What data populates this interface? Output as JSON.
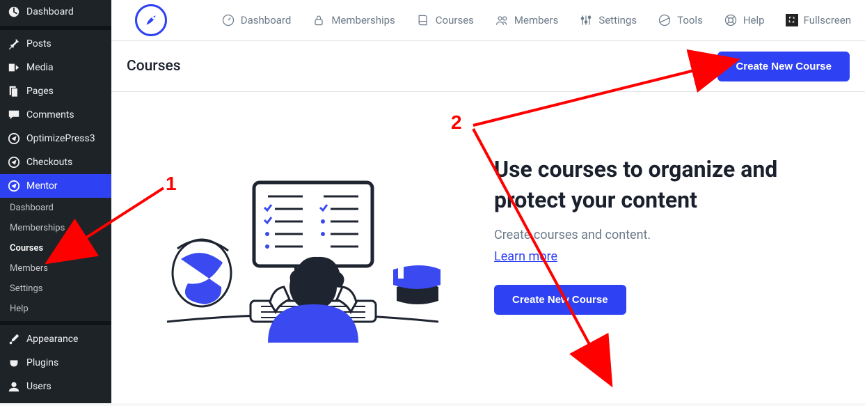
{
  "wp_sidebar": {
    "top": [
      {
        "label": "Dashboard",
        "icon": "dashboard"
      },
      {
        "label": "Posts",
        "icon": "pin"
      },
      {
        "label": "Media",
        "icon": "media"
      },
      {
        "label": "Pages",
        "icon": "page"
      },
      {
        "label": "Comments",
        "icon": "comment"
      },
      {
        "label": "OptimizePress3",
        "icon": "op"
      },
      {
        "label": "Checkouts",
        "icon": "op"
      },
      {
        "label": "Mentor",
        "icon": "op",
        "active": true
      }
    ],
    "sub": [
      {
        "label": "Dashboard"
      },
      {
        "label": "Memberships"
      },
      {
        "label": "Courses",
        "active": true
      },
      {
        "label": "Members"
      },
      {
        "label": "Settings"
      },
      {
        "label": "Help"
      }
    ],
    "bottom": [
      {
        "label": "Appearance",
        "icon": "brush"
      },
      {
        "label": "Plugins",
        "icon": "plug"
      },
      {
        "label": "Users",
        "icon": "user"
      }
    ]
  },
  "topnav": [
    {
      "label": "Dashboard",
      "icon": "gauge"
    },
    {
      "label": "Memberships",
      "icon": "lock"
    },
    {
      "label": "Courses",
      "icon": "book"
    },
    {
      "label": "Members",
      "icon": "people"
    },
    {
      "label": "Settings",
      "icon": "sliders"
    },
    {
      "label": "Tools",
      "icon": "target"
    },
    {
      "label": "Help",
      "icon": "lifebuoy"
    },
    {
      "label": "Fullscreen",
      "icon": "fullscreen"
    }
  ],
  "page": {
    "title": "Courses",
    "create_btn": "Create New Course"
  },
  "hero": {
    "heading": "Use courses to organize and protect your content",
    "sub": "Create courses and content.",
    "link": "Learn more",
    "button": "Create New Course"
  },
  "annotations": {
    "n1": "1",
    "n2": "2"
  }
}
